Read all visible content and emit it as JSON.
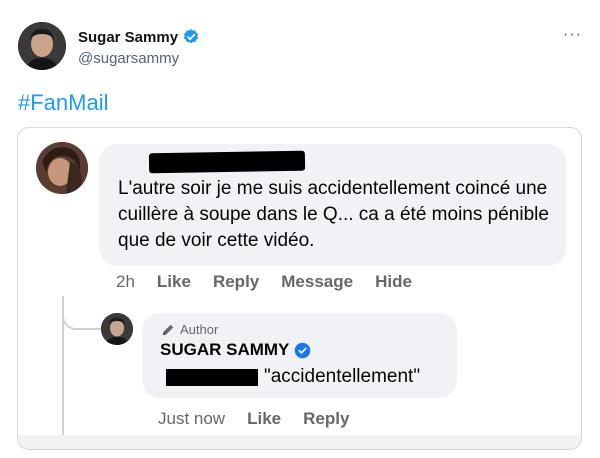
{
  "tweet": {
    "author_name": "Sugar Sammy",
    "handle": "@sugarsammy",
    "more_icon": "more-icon",
    "hashtag": "#FanMail"
  },
  "comment": {
    "text": "L'autre soir je me suis accidentellement coincé une cuillère à soupe dans le Q... ca a été moins pénible que de voir cette vidéo.",
    "time": "2h",
    "actions": [
      "Like",
      "Reply",
      "Message",
      "Hide"
    ]
  },
  "reply": {
    "badge": "Author",
    "name": "SUGAR SAMMY",
    "text": "\"accidentellement\"",
    "time": "Just now",
    "actions": [
      "Like",
      "Reply"
    ]
  },
  "colors": {
    "link_blue": "#1d9bf0",
    "verified_blue": "#1d9bf0",
    "fb_bubble": "#f0f2f5",
    "fb_gray": "#65676b",
    "fb_verified": "#1877f2"
  }
}
